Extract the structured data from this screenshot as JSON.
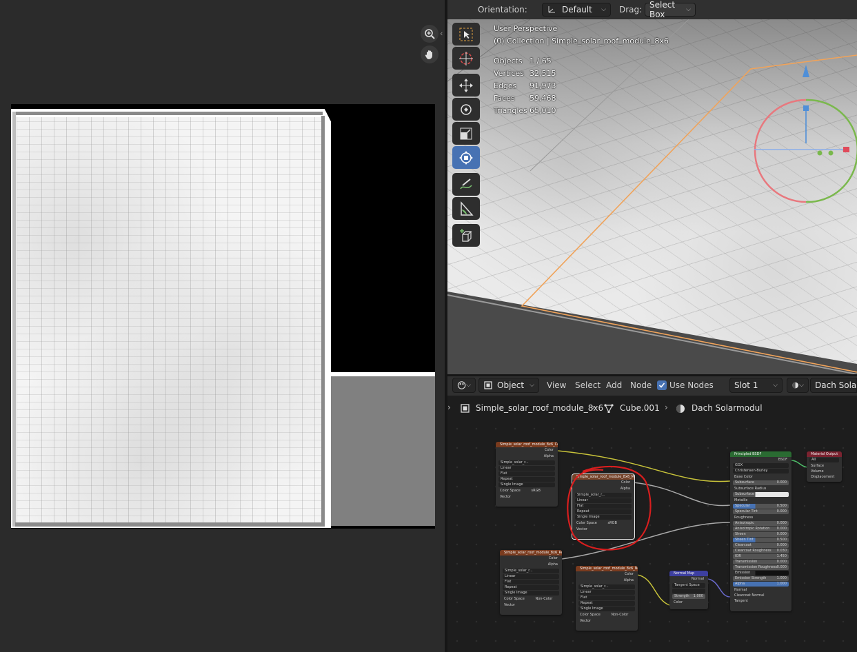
{
  "image_editor": {
    "zoom_icon": "zoom-in-icon",
    "pan_icon": "hand-pan-icon",
    "sidebar_toggle": "‹"
  },
  "viewport": {
    "header": {
      "orientation_label": "Orientation:",
      "orientation_value": "Default",
      "drag_label": "Drag:",
      "drag_value": "Select Box"
    },
    "overlay": {
      "perspective": "User Perspective",
      "collection": "(0) Collection | Simple_solar_roof_module_8x6",
      "stats": [
        {
          "label": "Objects",
          "value": "1 / 65"
        },
        {
          "label": "Vertices",
          "value": "32,515"
        },
        {
          "label": "Edges",
          "value": "91,973"
        },
        {
          "label": "Faces",
          "value": "59,468"
        },
        {
          "label": "Triangles",
          "value": "65,010"
        }
      ]
    },
    "tools": [
      "select-box-icon",
      "cursor-icon",
      "move-icon",
      "rotate-icon",
      "scale-icon",
      "transform-icon",
      "annotate-icon",
      "measure-icon",
      "add-cube-icon"
    ],
    "gizmo_colors": {
      "x": "#e04a5a",
      "y": "#7ab84c",
      "z": "#4f8fd8"
    }
  },
  "node_editor": {
    "header": {
      "mode": "Object",
      "menu": [
        "View",
        "Select",
        "Add",
        "Node"
      ],
      "use_nodes_label": "Use Nodes",
      "use_nodes_checked": true,
      "slot": "Slot 1",
      "material": "Dach Solarm"
    },
    "breadcrumb": {
      "object": "Simple_solar_roof_module_8x6",
      "mesh": "Cube.001",
      "material": "Dach Solarmodul"
    },
    "tex_nodes": [
      {
        "title": "Simple_solar_roof_module_8x6_Col",
        "image": "Simple_solar_r...",
        "interp": "Linear",
        "proj": "Flat",
        "ext": "Repeat",
        "source": "Single Image",
        "cs_label": "Color Space",
        "cs": "sRGB",
        "out1": "Color",
        "out2": "Alpha",
        "in": "Vector"
      },
      {
        "title": "Simple_solar_roof_module_8x6_Met",
        "image": "Simple_solar_r...",
        "interp": "Linear",
        "proj": "Flat",
        "ext": "Repeat",
        "source": "Single Image",
        "cs_label": "Color Space",
        "cs": "sRGB",
        "out1": "Color",
        "out2": "Alpha",
        "in": "Vector"
      },
      {
        "title": "Simple_solar_roof_module_8x6_Ro",
        "image": "Simple_solar_r...",
        "interp": "Linear",
        "proj": "Flat",
        "ext": "Repeat",
        "source": "Single Image",
        "cs_label": "Color Space",
        "cs": "Non-Color",
        "out1": "Color",
        "out2": "Alpha",
        "in": "Vector"
      },
      {
        "title": "Simple_solar_roof_module_8x6_No",
        "image": "Simple_solar_r...",
        "interp": "Linear",
        "proj": "Flat",
        "ext": "Repeat",
        "source": "Single Image",
        "cs_label": "Color Space",
        "cs": "Non-Color",
        "out1": "Color",
        "out2": "Alpha",
        "in": "Vector"
      }
    ],
    "normal_map": {
      "title": "Normal Map",
      "out": "Normal",
      "space": "Tangent Space",
      "strength_label": "Strength",
      "strength": "1.000",
      "in": "Color"
    },
    "bsdf": {
      "title": "Principled BSDF",
      "out": "BSDF",
      "distribution": "GGX",
      "subsurface_method": "Christensen-Burley",
      "rows": [
        {
          "label": "Base Color",
          "value": ""
        },
        {
          "label": "Subsurface",
          "value": "0.000"
        },
        {
          "label": "Subsurface Radius",
          "value": ""
        },
        {
          "label": "Subsurface ...",
          "value": ""
        },
        {
          "label": "Metallic",
          "value": ""
        },
        {
          "label": "Specular",
          "value": "0.500"
        },
        {
          "label": "Specular Tint",
          "value": "0.000"
        },
        {
          "label": "Roughness",
          "value": ""
        },
        {
          "label": "Anisotropic",
          "value": "0.000"
        },
        {
          "label": "Anisotropic Rotation",
          "value": "0.000"
        },
        {
          "label": "Sheen",
          "value": "0.000"
        },
        {
          "label": "Sheen Tint",
          "value": "0.500"
        },
        {
          "label": "Clearcoat",
          "value": "0.000"
        },
        {
          "label": "Clearcoat Roughness",
          "value": "0.030"
        },
        {
          "label": "IOR",
          "value": "1.450"
        },
        {
          "label": "Transmission",
          "value": "0.000"
        },
        {
          "label": "Transmission Roughness",
          "value": "0.000"
        },
        {
          "label": "Emission",
          "value": ""
        },
        {
          "label": "Emission Strength",
          "value": "1.000"
        },
        {
          "label": "Alpha",
          "value": "1.000"
        },
        {
          "label": "Normal",
          "value": ""
        },
        {
          "label": "Clearcoat Normal",
          "value": ""
        },
        {
          "label": "Tangent",
          "value": ""
        }
      ]
    },
    "output": {
      "title": "Material Output",
      "target": "All",
      "inputs": [
        "Surface",
        "Volume",
        "Displacement"
      ]
    },
    "highlight_color": "#d81e1e"
  }
}
